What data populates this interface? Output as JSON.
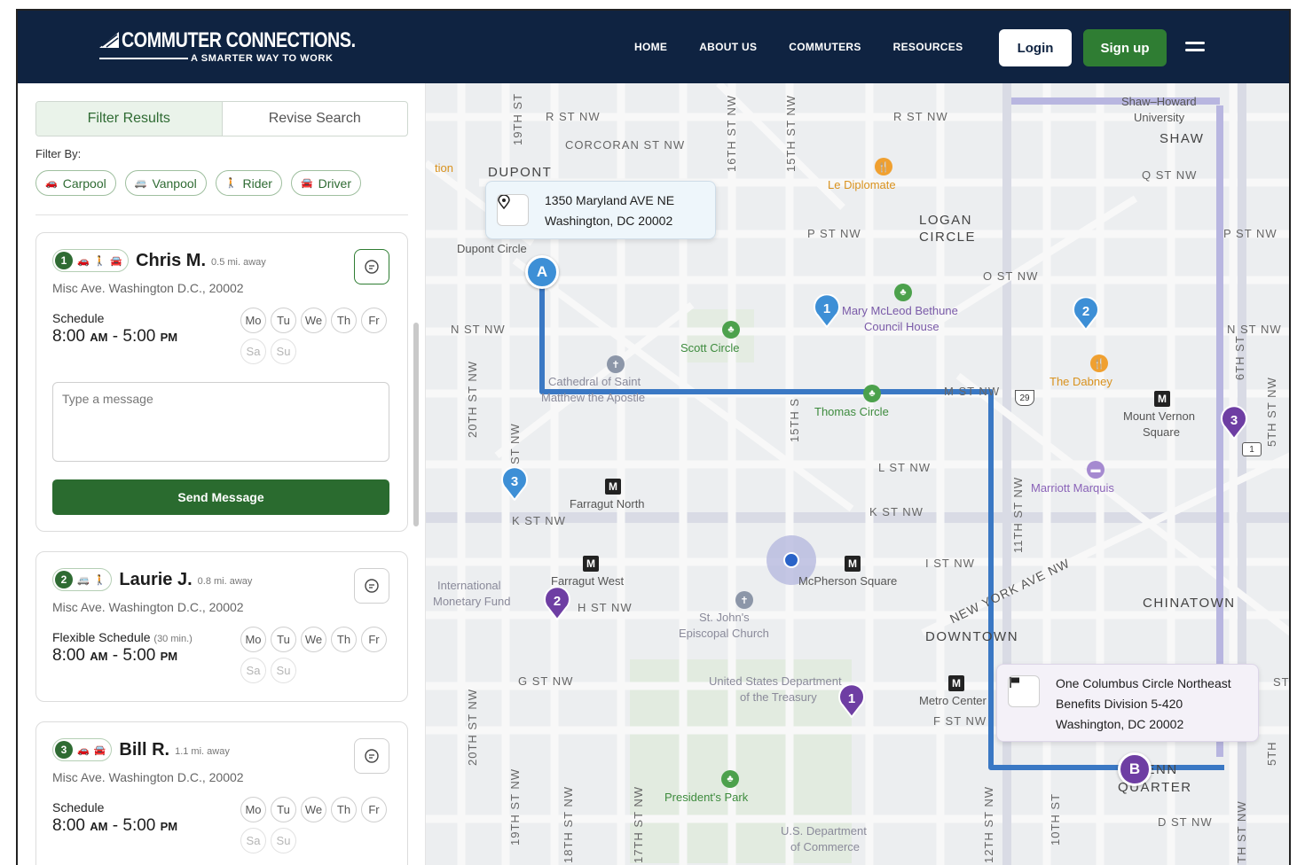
{
  "header": {
    "logo_title": "COMMUTER CONNECTIONS.",
    "logo_tagline": "A SMARTER WAY TO WORK",
    "nav": [
      "HOME",
      "ABOUT US",
      "COMMUTERS",
      "RESOURCES"
    ],
    "login_label": "Login",
    "signup_label": "Sign up"
  },
  "sidebar": {
    "tabs": [
      "Filter Results",
      "Revise Search"
    ],
    "filter_by_label": "Filter By:",
    "chips": [
      "Carpool",
      "Vanpool",
      "Rider",
      "Driver"
    ],
    "message_placeholder": "Type a message",
    "send_label": "Send Message",
    "cards": [
      {
        "number": "1",
        "name": "Chris M.",
        "distance": "0.5 mi. away",
        "address": "Misc Ave. Washington D.C., 20002",
        "schedule_label": "Schedule",
        "schedule_note": "",
        "time_start": "8:00",
        "time_start_ampm": "AM",
        "time_sep": "-",
        "time_end": "5:00",
        "time_end_ampm": "PM",
        "days": [
          "Mo",
          "Tu",
          "We",
          "Th",
          "Fr",
          "Sa",
          "Su"
        ]
      },
      {
        "number": "2",
        "name": "Laurie J.",
        "distance": "0.8 mi. away",
        "address": "Misc Ave. Washington D.C., 20002",
        "schedule_label": "Flexible Schedule",
        "schedule_note": "(30 min.)",
        "time_start": "8:00",
        "time_start_ampm": "AM",
        "time_sep": "-",
        "time_end": "5:00",
        "time_end_ampm": "PM",
        "days": [
          "Mo",
          "Tu",
          "We",
          "Th",
          "Fr",
          "Sa",
          "Su"
        ]
      },
      {
        "number": "3",
        "name": "Bill R.",
        "distance": "1.1 mi. away",
        "address": "Misc Ave. Washington D.C., 20002",
        "schedule_label": "Schedule",
        "schedule_note": "",
        "time_start": "8:00",
        "time_start_ampm": "AM",
        "time_sep": "-",
        "time_end": "5:00",
        "time_end_ampm": "PM",
        "days": [
          "Mo",
          "Tu",
          "We",
          "Th",
          "Fr",
          "Sa",
          "Su"
        ]
      }
    ]
  },
  "map": {
    "origin_popup": {
      "line1": "1350 Maryland AVE NE",
      "line2": "Washington, DC 20002"
    },
    "destination_popup": {
      "line1": "One Columbus Circle Northeast",
      "line2": "Benefits Division 5-420",
      "line3": "Washington, DC 20002"
    },
    "start_marker": "A",
    "end_marker": "B",
    "streets": {
      "r_st_left": "R ST NW",
      "r_st_right": "R ST NW",
      "corcoran": "CORCORAN ST NW",
      "q_st": "Q ST NW",
      "p_st": "P ST NW",
      "p_st_right": "P ST NW",
      "o_st": "O ST NW",
      "n_st_left": "N ST NW",
      "n_st_right": "N ST NW",
      "m_st": "M ST NW",
      "l_st": "L ST NW",
      "k_st_left": "K ST NW",
      "k_st_right": "K ST NW",
      "i_st": "I ST NW",
      "h_st": "H ST NW",
      "g_st": "G ST NW",
      "f_st": "F ST NW",
      "d_st": "D ST NW",
      "ny_ave": "NEW YORK AVE NW",
      "v19": "19TH ST",
      "v16": "16TH ST NW",
      "v15": "15TH ST NW",
      "v20": "20TH ST NW",
      "v20b": "20TH ST NW",
      "v19b": "19TH ST NW",
      "v18": "18TH ST NW",
      "v17": "17TH ST NW",
      "v15s": "15TH S",
      "v21": "ST NW",
      "v11": "11TH ST NW",
      "v12": "12TH ST NW",
      "v10": "10TH ST",
      "v6": "6TH ST",
      "v5": "5TH ST NW",
      "v5b": "5TH",
      "v7": "TH ST NW",
      "st_edge": "ST",
      "route_29": "29",
      "route_1": "1"
    },
    "places": {
      "dupont": "DUPONT",
      "dupont_circle": "Dupont Circle",
      "logan": "LOGAN",
      "logan2": "CIRCLE",
      "shaw_howard": "Shaw–Howard",
      "university": "University",
      "shaw": "SHAW",
      "le_diplomate": "Le Diplomate",
      "mary_mcleod": "Mary McLeod Bethune",
      "council_house": "Council House",
      "scott_circle": "Scott Circle",
      "cathedral1": "Cathedral of Saint",
      "cathedral2": "Matthew the Apostle",
      "thomas_circle": "Thomas Circle",
      "the_dabney": "The Dabney",
      "mount_vernon": "Mount Vernon",
      "square": "Square",
      "marriott": "Marriott Marquis",
      "farragut_north": "Farragut North",
      "farragut_west": "Farragut West",
      "mcpherson": "McPherson Square",
      "imf1": "International",
      "imf2": "Monetary Fund",
      "st_johns1": "St. John's",
      "st_johns2": "Episcopal Church",
      "chinatown": "CHINATOWN",
      "downtown": "DOWNTOWN",
      "treasury1": "United States Department",
      "treasury2": "of the Treasury",
      "metro_center": "Metro Center",
      "presidents_park": "President's Park",
      "commerce1": "U.S. Department",
      "commerce2": "of Commerce",
      "penn": "PENN",
      "quarter": "QUARTER",
      "edge_tion": "tion"
    },
    "metro_glyph": "M",
    "pins_blue": [
      "1",
      "2",
      "3"
    ],
    "pins_purple": [
      "1",
      "2",
      "3"
    ]
  },
  "colors": {
    "header_bg": "#0f2341",
    "brand_green": "#2f7d33",
    "route_blue": "#3a78c4",
    "pin_blue": "#3d8fd6",
    "pin_purple": "#6e3ea3"
  }
}
